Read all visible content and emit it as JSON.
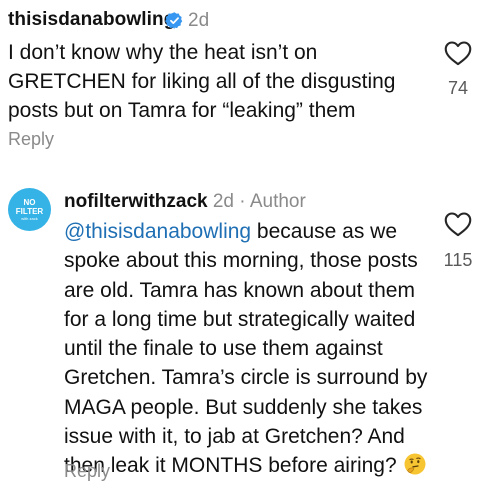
{
  "comment1": {
    "username": "thisisdanabowling",
    "time": "2d",
    "text": "I don’t know why the heat isn’t on GRETCHEN for liking all of the disgusting posts but on Tamra for “leaking” them",
    "reply_label": "Reply",
    "likes": "74"
  },
  "comment2": {
    "username": "nofilterwithzack",
    "time": "2d",
    "separator": "·",
    "author_label": "Author",
    "avatar_line1": "NO",
    "avatar_line2": "FILTER",
    "avatar_line3": "with zack",
    "mention": "@thisisdanabowling",
    "text": " because as we spoke about this morning, those posts are old. Tamra has known about them for a long time but strategically waited until the finale to use them against Gretchen. Tamra’s circle is surround by MAGA people. But suddenly she takes issue with it, to jab at Gretchen? And then leak it MONTHS before airing?",
    "reply_label": "Reply",
    "likes": "115"
  },
  "icons": {
    "verified": "verified-badge-icon",
    "heart": "heart-outline-icon",
    "emoji": "thinking-face-emoji"
  },
  "colors": {
    "verified": "#3897f0",
    "mention": "#1f6fb4",
    "avatar": "#35b3e6",
    "secondary_text": "#8a8a8a"
  }
}
